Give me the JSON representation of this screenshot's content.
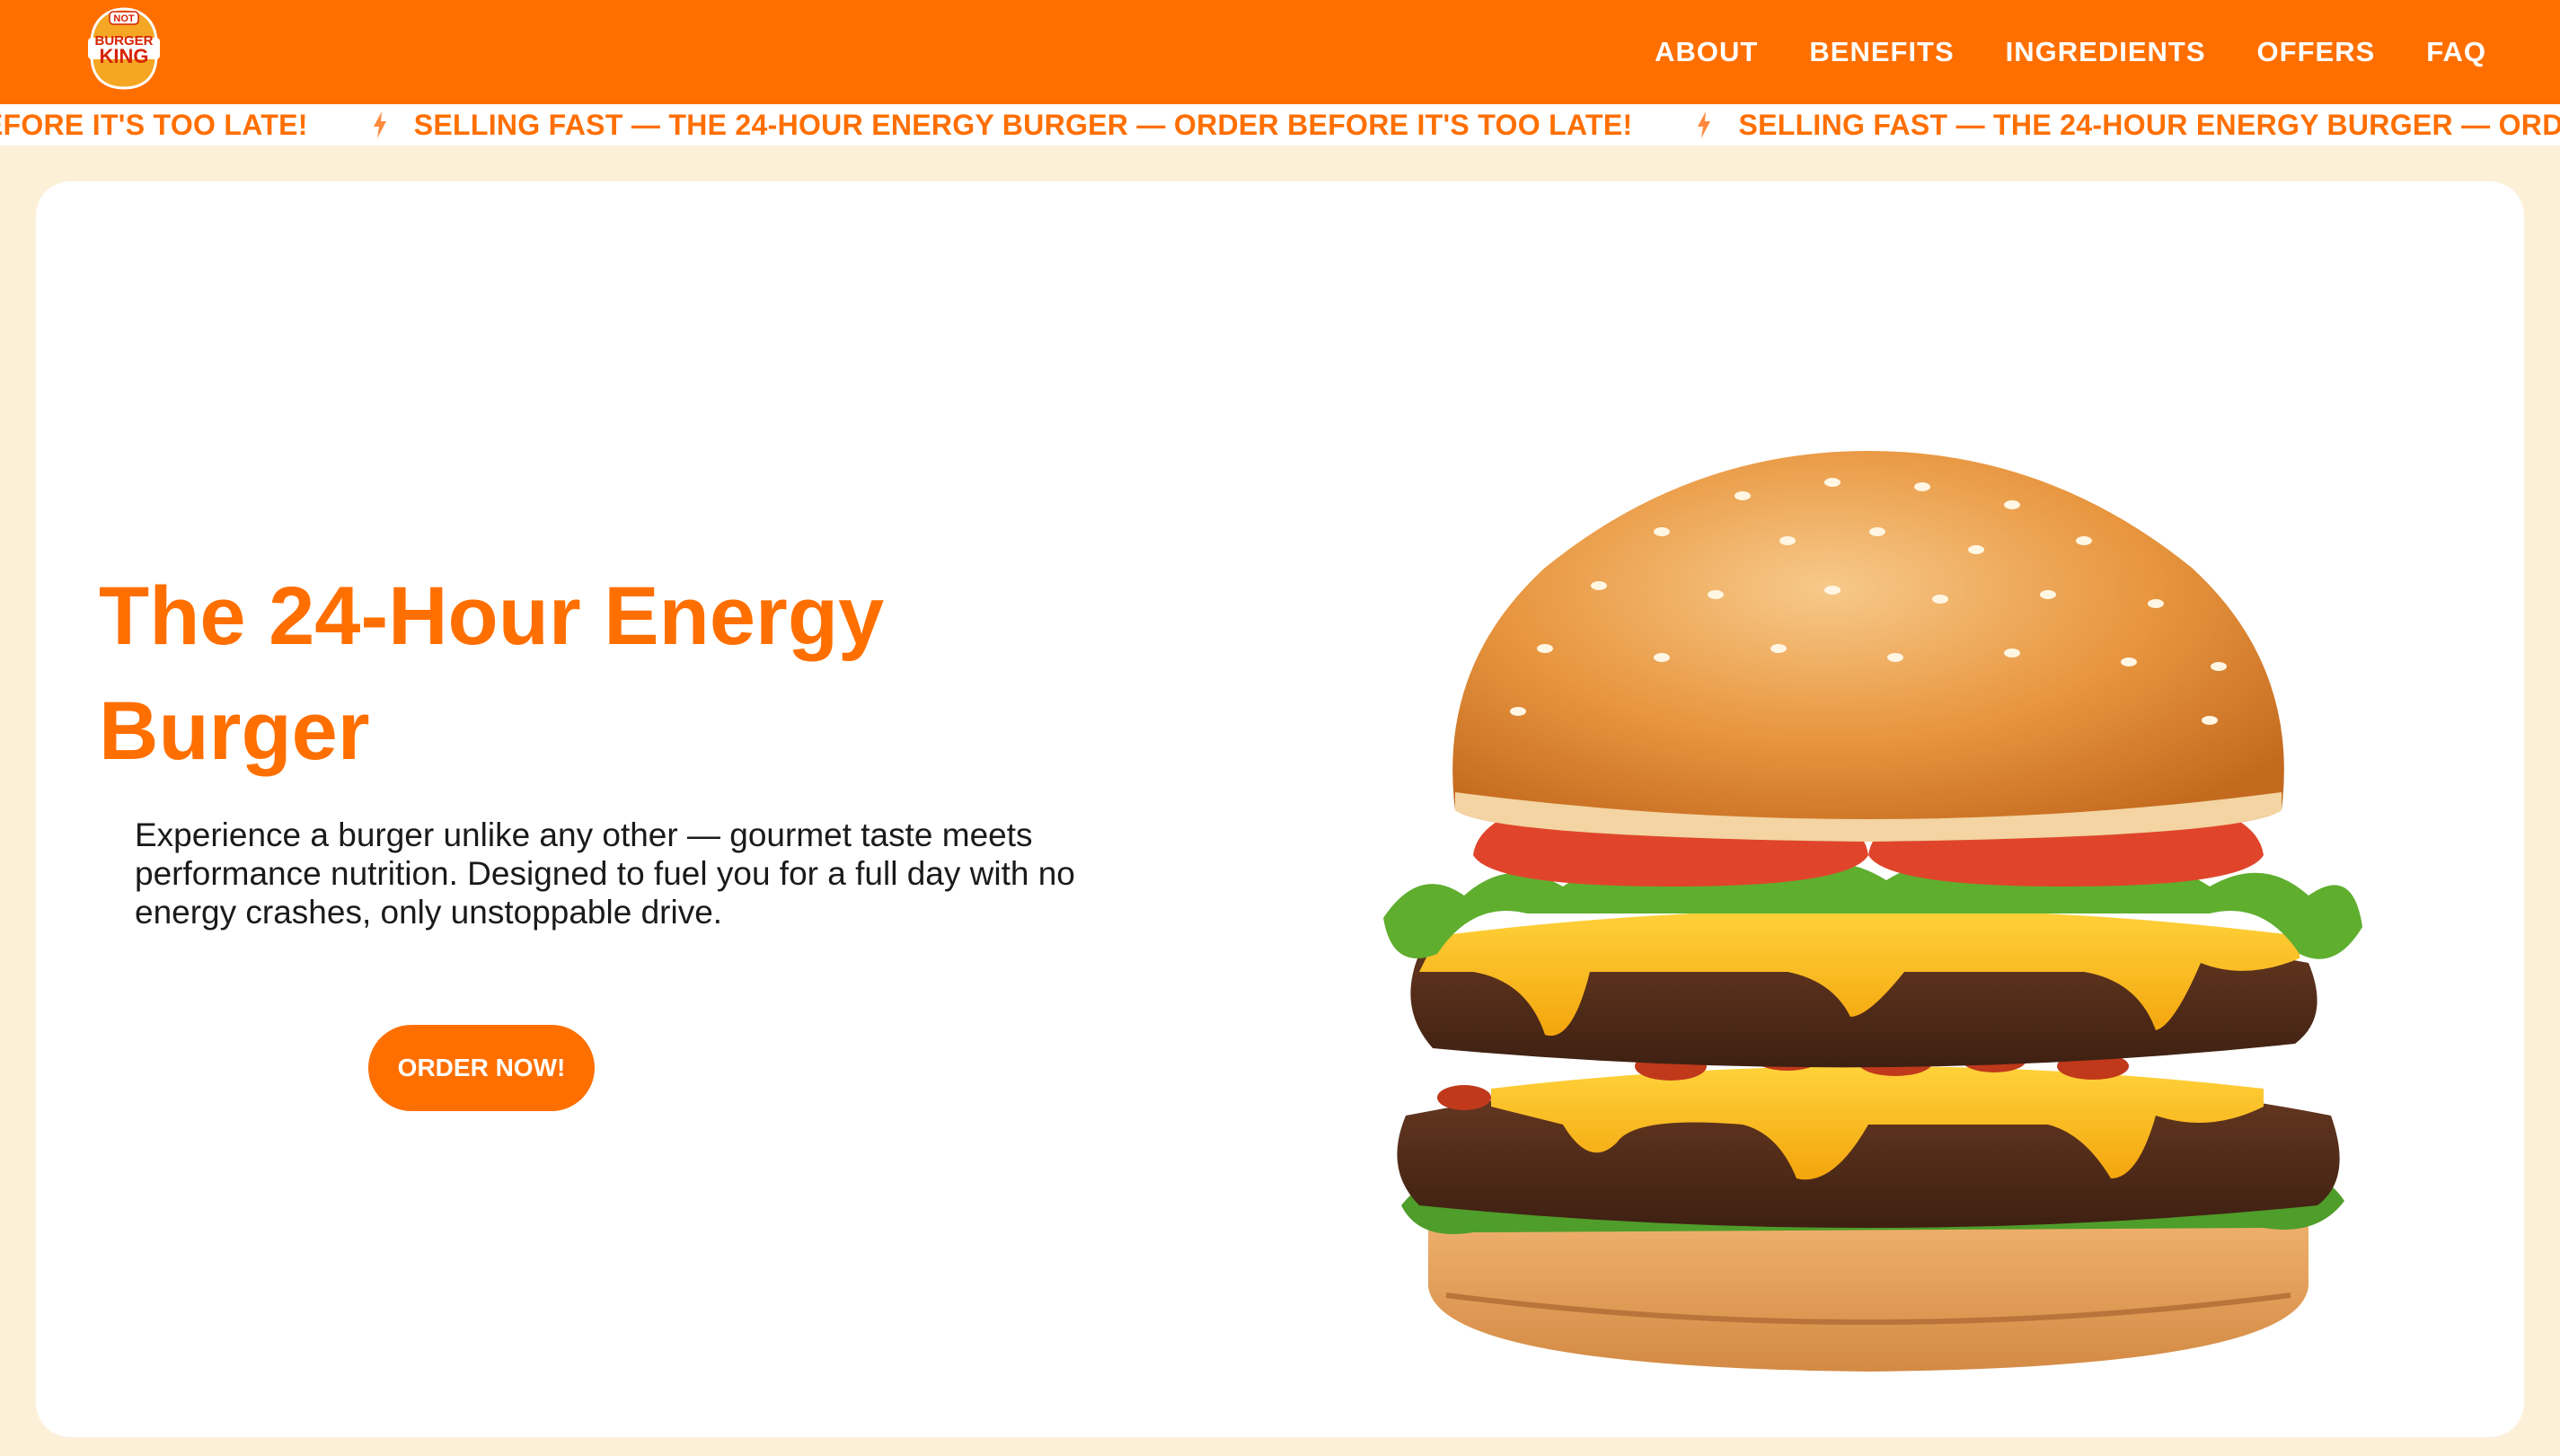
{
  "brand": {
    "logo_line1": "NOT",
    "logo_line2": "BURGER",
    "logo_line3": "KING"
  },
  "nav": {
    "items": [
      "ABOUT",
      "BENEFITS",
      "INGREDIENTS",
      "OFFERS",
      "FAQ"
    ]
  },
  "ticker": {
    "message": "SELLING FAST — THE 24-HOUR ENERGY BURGER — ORDER BEFORE IT'S TOO LATE!"
  },
  "hero": {
    "title": "The 24-Hour Energy Burger",
    "description": "Experience a burger unlike any other — gourmet taste meets performance nutrition. Designed to fuel you for a full day with no energy crashes, only unstoppable drive.",
    "cta_label": "ORDER NOW!"
  },
  "colors": {
    "brand_orange": "#ff6f00",
    "page_background": "#fcf0d8",
    "card_background": "#ffffff",
    "text_dark": "#1a1a1a"
  },
  "icons": {
    "logo": "burger-logo-icon",
    "ticker_separator": "lightning-bolt-icon",
    "hero_image": "burger-image"
  }
}
